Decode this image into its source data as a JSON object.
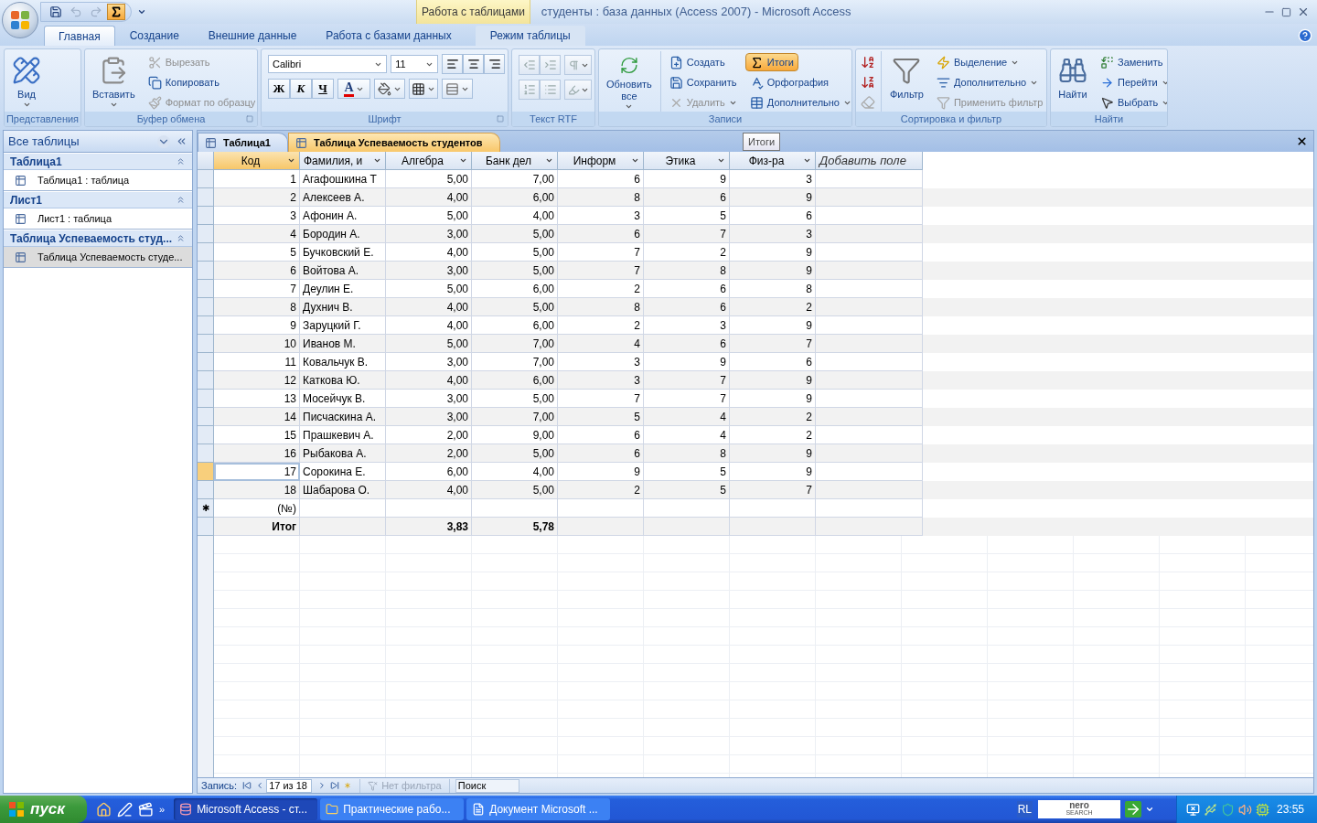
{
  "window": {
    "title": "студенты : база данных (Access 2007) - Microsoft Access",
    "context_group": "Работа с таблицами"
  },
  "quick_access": [
    {
      "kind": "save",
      "disabled": false,
      "pressed": false
    },
    {
      "kind": "undo",
      "disabled": true,
      "pressed": false
    },
    {
      "kind": "redo",
      "disabled": true,
      "pressed": false
    },
    {
      "kind": "totals",
      "disabled": false,
      "pressed": true
    }
  ],
  "tabs": [
    {
      "label": "Главная",
      "selected": true,
      "contextual": false
    },
    {
      "label": "Создание",
      "selected": false,
      "contextual": false
    },
    {
      "label": "Внешние данные",
      "selected": false,
      "contextual": false
    },
    {
      "label": "Работа с базами данных",
      "selected": false,
      "contextual": false
    },
    {
      "label": "Режим таблицы",
      "selected": false,
      "contextual": true
    }
  ],
  "ribbon": [
    {
      "kind": "buttons",
      "label": "Представления",
      "launcher": false,
      "items": [
        {
          "label": "Вид",
          "kind": "large",
          "dropdown": true,
          "disabled": false,
          "pressed": false
        }
      ]
    },
    {
      "kind": "buttons",
      "label": "Буфер обмена",
      "launcher": true,
      "items": [
        {
          "label": "Вставить",
          "kind": "large",
          "dropdown": true,
          "disabled": false,
          "pressed": false
        },
        {
          "label": "Вырезать",
          "kind": "small",
          "dropdown": false,
          "disabled": true,
          "pressed": false
        },
        {
          "label": "Копировать",
          "kind": "small",
          "dropdown": false,
          "disabled": false,
          "pressed": false
        },
        {
          "label": "Формат по образцу",
          "kind": "small",
          "dropdown": false,
          "disabled": true,
          "pressed": false
        }
      ]
    },
    {
      "kind": "font",
      "label": "Шрифт",
      "launcher": true,
      "font": "Calibri",
      "size": "11",
      "bold": "Ж",
      "italic": "К",
      "underline": "Ч",
      "color_letter": "А"
    },
    {
      "kind": "rtf",
      "label": "Текст RTF",
      "launcher": false,
      "buttons": [
        {
          "disabled": true
        },
        {
          "disabled": true
        },
        {
          "disabled": true
        },
        {
          "disabled": true
        },
        {
          "disabled": true
        },
        {
          "disabled": true
        }
      ]
    },
    {
      "kind": "buttons",
      "label": "Записи",
      "launcher": false,
      "items": [
        {
          "label": "Обновить все",
          "kind": "large",
          "dropdown": true,
          "disabled": false,
          "pressed": false
        },
        {
          "label": "Создать",
          "kind": "small",
          "dropdown": false,
          "disabled": false,
          "pressed": false
        },
        {
          "label": "Сохранить",
          "kind": "small",
          "dropdown": false,
          "disabled": false,
          "pressed": false
        },
        {
          "label": "Удалить",
          "kind": "small",
          "dropdown": true,
          "disabled": true,
          "pressed": false
        },
        {
          "label": "Итоги",
          "kind": "small",
          "dropdown": false,
          "disabled": false,
          "pressed": true
        },
        {
          "label": "Орфография",
          "kind": "small",
          "dropdown": false,
          "disabled": false,
          "pressed": false
        },
        {
          "label": "Дополнительно",
          "kind": "small",
          "dropdown": true,
          "disabled": false,
          "pressed": false
        }
      ]
    },
    {
      "kind": "sort",
      "label": "Сортировка и фильтр",
      "launcher": false,
      "sort_buttons": [
        {
          "disabled": false
        },
        {
          "disabled": false
        },
        {
          "disabled": true
        }
      ],
      "items": [
        {
          "label": "Фильтр",
          "kind": "large",
          "dropdown": false,
          "disabled": false,
          "pressed": false
        },
        {
          "label": "Выделение",
          "kind": "small",
          "dropdown": true,
          "disabled": false,
          "pressed": false
        },
        {
          "label": "Дополнительно",
          "kind": "small",
          "dropdown": true,
          "disabled": false,
          "pressed": false
        },
        {
          "label": "Применить фильтр",
          "kind": "small",
          "dropdown": false,
          "disabled": true,
          "pressed": false
        }
      ]
    },
    {
      "kind": "buttons",
      "label": "Найти",
      "launcher": false,
      "items": [
        {
          "label": "Найти",
          "kind": "large",
          "dropdown": false,
          "disabled": false,
          "pressed": false
        },
        {
          "label": "Заменить",
          "kind": "small",
          "dropdown": false,
          "disabled": false,
          "pressed": false
        },
        {
          "label": "Перейти",
          "kind": "small",
          "dropdown": true,
          "disabled": false,
          "pressed": false
        },
        {
          "label": "Выбрать",
          "kind": "small",
          "dropdown": true,
          "disabled": false,
          "pressed": false
        }
      ]
    }
  ],
  "nav_pane": {
    "title": "Все таблицы",
    "groups": [
      {
        "title": "Таблица1",
        "expanded": true,
        "items": [
          {
            "label": "Таблица1 : таблица",
            "selected": false
          }
        ]
      },
      {
        "title": "Лист1",
        "expanded": true,
        "items": [
          {
            "label": "Лист1 : таблица",
            "selected": false
          }
        ]
      },
      {
        "title": "Таблица Успеваемость студ...",
        "expanded": true,
        "items": [
          {
            "label": "Таблица Успеваемость студе...",
            "selected": true
          }
        ]
      }
    ]
  },
  "doc_tabs": [
    {
      "label": "Таблица1",
      "selected": false
    },
    {
      "label": "Таблица Успеваемость студентов",
      "selected": true
    }
  ],
  "tooltip": "Итоги",
  "table": {
    "columns": [
      {
        "label": "Код",
        "kind": "number",
        "selected": true
      },
      {
        "label": "Фамилия, и",
        "kind": "text",
        "selected": false
      },
      {
        "label": "Алгебра",
        "kind": "number",
        "selected": false
      },
      {
        "label": "Банк дел",
        "kind": "number",
        "selected": false
      },
      {
        "label": "Информ",
        "kind": "number",
        "selected": false
      },
      {
        "label": "Этика",
        "kind": "number",
        "selected": false
      },
      {
        "label": "Физ-ра",
        "kind": "number",
        "selected": false
      },
      {
        "label": "Добавить поле",
        "kind": "add",
        "selected": false
      }
    ],
    "rows": [
      {
        "selected": false,
        "cells": [
          "1",
          "Агафошкина Т",
          "5,00",
          "7,00",
          "6",
          "9",
          "3"
        ]
      },
      {
        "selected": false,
        "cells": [
          "2",
          "Алексеев А.",
          "4,00",
          "6,00",
          "8",
          "6",
          "9"
        ]
      },
      {
        "selected": false,
        "cells": [
          "3",
          "Афонин А.",
          "5,00",
          "4,00",
          "3",
          "5",
          "6"
        ]
      },
      {
        "selected": false,
        "cells": [
          "4",
          "Бородин А.",
          "3,00",
          "5,00",
          "6",
          "7",
          "3"
        ]
      },
      {
        "selected": false,
        "cells": [
          "5",
          "Бучковский Е.",
          "4,00",
          "5,00",
          "7",
          "2",
          "9"
        ]
      },
      {
        "selected": false,
        "cells": [
          "6",
          "Войтова А.",
          "3,00",
          "5,00",
          "7",
          "8",
          "9"
        ]
      },
      {
        "selected": false,
        "cells": [
          "7",
          "Деулин Е.",
          "5,00",
          "6,00",
          "2",
          "6",
          "8"
        ]
      },
      {
        "selected": false,
        "cells": [
          "8",
          "Духнич В.",
          "4,00",
          "5,00",
          "8",
          "6",
          "2"
        ]
      },
      {
        "selected": false,
        "cells": [
          "9",
          "Заруцкий Г.",
          "4,00",
          "6,00",
          "2",
          "3",
          "9"
        ]
      },
      {
        "selected": false,
        "cells": [
          "10",
          "Иванов М.",
          "5,00",
          "7,00",
          "4",
          "6",
          "7"
        ]
      },
      {
        "selected": false,
        "cells": [
          "11",
          "Ковальчук В.",
          "3,00",
          "7,00",
          "3",
          "9",
          "6"
        ]
      },
      {
        "selected": false,
        "cells": [
          "12",
          "Каткова Ю.",
          "4,00",
          "6,00",
          "3",
          "7",
          "9"
        ]
      },
      {
        "selected": false,
        "cells": [
          "13",
          "Мосейчук В.",
          "3,00",
          "5,00",
          "7",
          "7",
          "9"
        ]
      },
      {
        "selected": false,
        "cells": [
          "14",
          "Писчаскина А.",
          "3,00",
          "7,00",
          "5",
          "4",
          "2"
        ]
      },
      {
        "selected": false,
        "cells": [
          "15",
          "Прашкевич А.",
          "2,00",
          "9,00",
          "6",
          "4",
          "2"
        ]
      },
      {
        "selected": false,
        "cells": [
          "16",
          "Рыбакова А.",
          "2,00",
          "5,00",
          "6",
          "8",
          "9"
        ]
      },
      {
        "selected": true,
        "cells": [
          "17",
          "Сорокина Е.",
          "6,00",
          "4,00",
          "9",
          "5",
          "9"
        ]
      },
      {
        "selected": false,
        "cells": [
          "18",
          "Шабарова О.",
          "4,00",
          "5,00",
          "2",
          "5",
          "7"
        ]
      }
    ],
    "new_row": {
      "marker": "✱",
      "value": "(№)"
    },
    "totals": {
      "label": "Итог",
      "algebra": "3,83",
      "bank": "5,78"
    }
  },
  "record_nav": {
    "label": "Запись:",
    "position": "17 из 18",
    "filter": "Нет фильтра",
    "filter_disabled": true,
    "search_placeholder": "Поиск"
  },
  "taskbar": {
    "start": "пуск",
    "more": "»",
    "tasks": [
      {
        "label": "Microsoft Access - ст...",
        "selected": true
      },
      {
        "label": "Практические рабо...",
        "selected": false
      },
      {
        "label": "Документ Microsoft ...",
        "selected": false
      }
    ],
    "language": "RL",
    "search_logo": {
      "top": "nero",
      "bottom": "SEARCH"
    },
    "clock": "23:55"
  }
}
